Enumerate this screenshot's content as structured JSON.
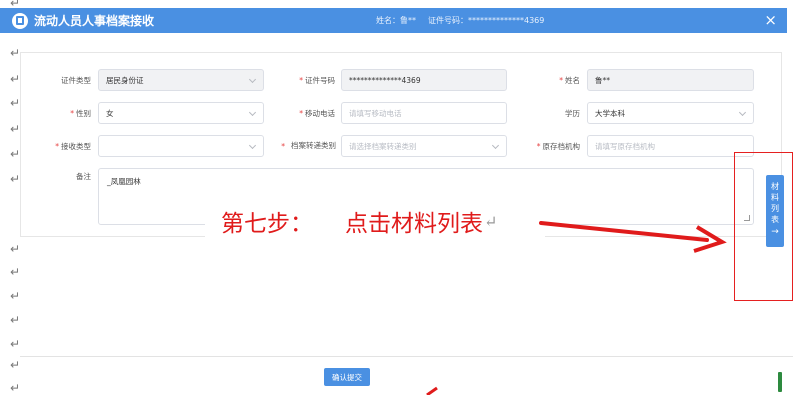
{
  "header": {
    "title": "流动人员人事档案接收",
    "name_label": "姓名：",
    "name_value": "鲁**",
    "id_label": "证件号码：",
    "id_value": "**************4369",
    "close": "×"
  },
  "form": {
    "id_type": {
      "label": "证件类型",
      "value": "居民身份证"
    },
    "id_number": {
      "label": "证件号码",
      "value": "**************4369"
    },
    "name": {
      "label": "姓名",
      "value": "鲁**"
    },
    "gender": {
      "label": "性别",
      "value": "女"
    },
    "mobile": {
      "label": "移动电话",
      "placeholder": "请填写移动电话"
    },
    "education": {
      "label": "学历",
      "value": "大学本科"
    },
    "receive_type": {
      "label": "接收类型",
      "value": ""
    },
    "transfer_category": {
      "label": "档案转递类别",
      "placeholder": "请选择档案转递类别"
    },
    "original_org": {
      "label": "原存档机构",
      "placeholder": "请填写原存档机构"
    },
    "remark": {
      "label": "备注",
      "value": "_凤凰园林"
    }
  },
  "instruction": {
    "step": "第七步：",
    "action": "点击材料列表"
  },
  "side_tab": {
    "chars": [
      "材",
      "料",
      "列",
      "表"
    ],
    "arrow": "→"
  },
  "submit_label": "确认提交",
  "paragraph_mark": "↵",
  "colors": {
    "accent": "#4a90e2",
    "annotation_red": "#e01b1b",
    "required": "#e64242"
  }
}
